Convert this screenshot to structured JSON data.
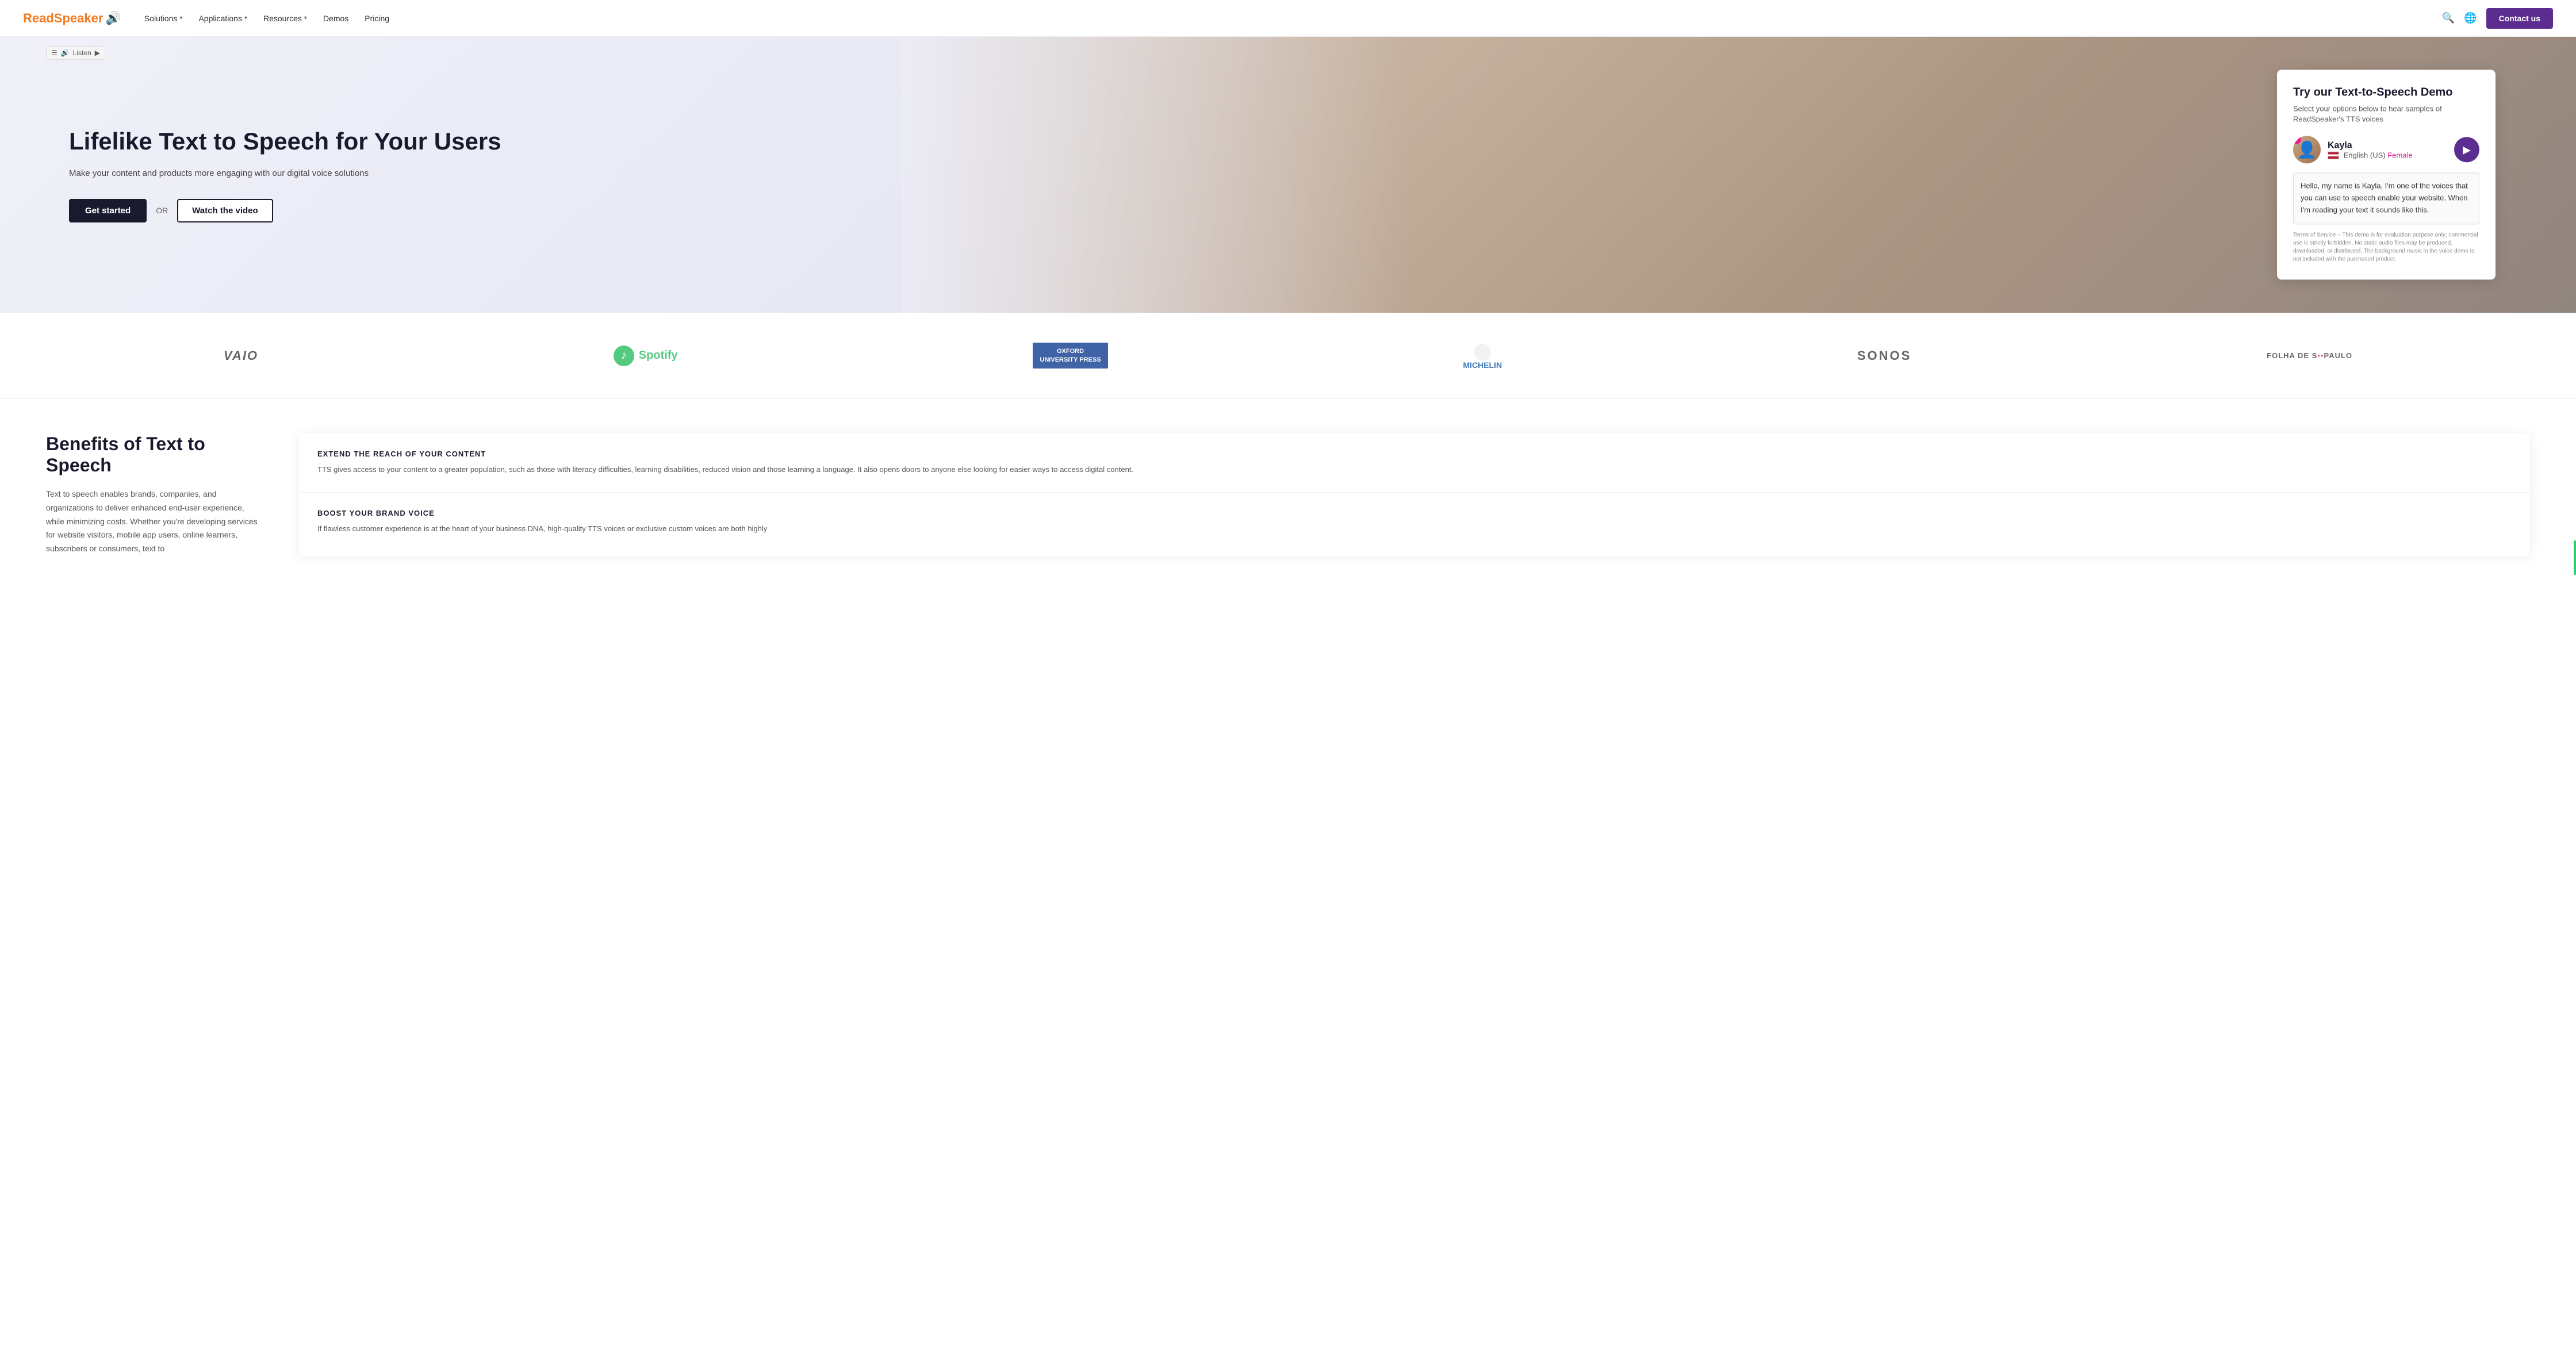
{
  "nav": {
    "logo_text": "ReadSpeaker",
    "links": [
      {
        "label": "Solutions",
        "has_dropdown": true
      },
      {
        "label": "Applications",
        "has_dropdown": true
      },
      {
        "label": "Resources",
        "has_dropdown": true
      },
      {
        "label": "Demos",
        "has_dropdown": false
      },
      {
        "label": "Pricing",
        "has_dropdown": false
      }
    ],
    "contact_label": "Contact us"
  },
  "listen_bar": {
    "label": "Listen"
  },
  "hero": {
    "title": "Lifelike Text to Speech for Your Users",
    "subtitle": "Make your content and products more engaging with our digital voice solutions",
    "cta_primary": "Get started",
    "cta_or": "OR",
    "cta_secondary": "Watch the video"
  },
  "demo_card": {
    "title": "Try our Text-to-Speech Demo",
    "subtitle": "Select your options below to hear samples of ReadSpeaker's TTS voices",
    "voice_name": "Kayla",
    "voice_lang": "English (US)",
    "voice_gender": "Female",
    "demo_text": "Hello, my name is Kayla, I'm one of the voices that you can use to speech enable your website. When I'm reading your text it sounds like this.",
    "terms": "Terms of Service – This demo is for evaluation purpose only; commercial use is strictly forbidden. No static audio files may be produced, downloaded, or distributed. The background music in the voice demo is not included with the purchased product."
  },
  "logos": {
    "items": [
      {
        "name": "VAIO",
        "type": "vaio"
      },
      {
        "name": "Spotify",
        "type": "spotify"
      },
      {
        "name": "Oxford University Press",
        "type": "oxford"
      },
      {
        "name": "Michelin",
        "type": "michelin"
      },
      {
        "name": "SONOS",
        "type": "sonos"
      },
      {
        "name": "Folha de S.Paulo",
        "type": "folha"
      }
    ]
  },
  "benefits": {
    "title": "Benefits of Text to Speech",
    "text": "Text to speech enables brands, companies, and organizations to deliver enhanced end-user experience, while minimizing costs. Whether you're developing services for website visitors, mobile app users, online learners, subscribers or consumers, text to",
    "items": [
      {
        "title": "EXTEND THE REACH OF YOUR CONTENT",
        "text": "TTS gives access to your content to a greater population, such as those with literacy difficulties, learning disabilities, reduced vision and those learning a language. It also opens doors to anyone else looking for easier ways to access digital content."
      },
      {
        "title": "BOOST YOUR BRAND VOICE",
        "text": "If flawless customer experience is at the heart of your business DNA, high-quality TTS voices or exclusive custom voices are both highly"
      }
    ]
  }
}
